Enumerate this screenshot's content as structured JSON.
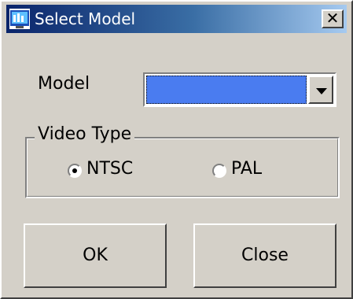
{
  "window": {
    "title": "Select Model",
    "close_symbol": "✕"
  },
  "model": {
    "label": "Model",
    "selected_value": ""
  },
  "video_type": {
    "legend": "Video Type",
    "options": [
      {
        "label": "NTSC",
        "selected": true
      },
      {
        "label": "PAL",
        "selected": false
      }
    ]
  },
  "buttons": {
    "ok": "OK",
    "close": "Close"
  },
  "colors": {
    "titlebar_start": "#0a246a",
    "titlebar_end": "#a6caf0",
    "selection": "#4a7cf0",
    "face": "#d4d0c8"
  },
  "icons": {
    "app": "monitor-icon",
    "dropdown": "chevron-down-icon",
    "close": "close-icon"
  }
}
